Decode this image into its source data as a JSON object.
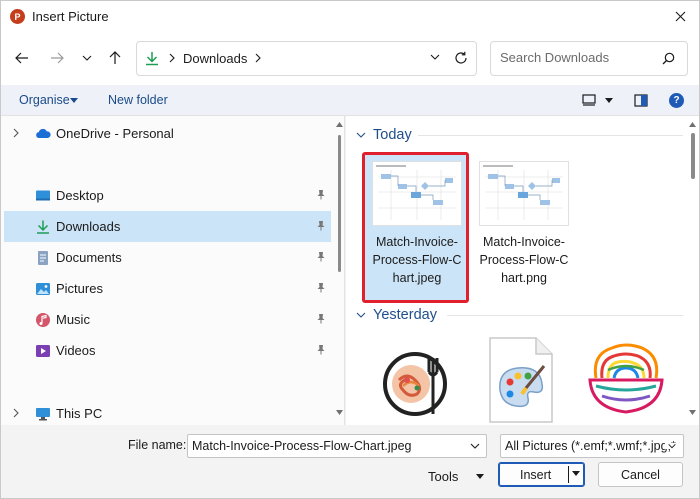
{
  "window": {
    "title": "Insert Picture",
    "app_icon_letter": "P",
    "app_color": "#c43e1c"
  },
  "address": {
    "location": "Downloads",
    "icon": "download-arrow-icon"
  },
  "search": {
    "placeholder": "Search Downloads"
  },
  "toolbar": {
    "organise_label": "Organise",
    "new_folder_label": "New folder",
    "help_label": "?"
  },
  "sidebar": {
    "items": [
      {
        "label": "OneDrive - Personal",
        "icon": "onedrive-cloud-icon",
        "pinned": false,
        "expandable": true
      },
      {
        "label": "Desktop",
        "icon": "desktop-icon",
        "pinned": true
      },
      {
        "label": "Downloads",
        "icon": "download-arrow-icon",
        "pinned": true,
        "selected": true
      },
      {
        "label": "Documents",
        "icon": "documents-icon",
        "pinned": true
      },
      {
        "label": "Pictures",
        "icon": "pictures-icon",
        "pinned": true
      },
      {
        "label": "Music",
        "icon": "music-icon",
        "pinned": true
      },
      {
        "label": "Videos",
        "icon": "videos-icon",
        "pinned": true
      },
      {
        "label": "This PC",
        "icon": "this-pc-icon",
        "pinned": false,
        "expandable": true
      }
    ]
  },
  "content": {
    "groups": [
      {
        "label": "Today",
        "files": [
          {
            "name": "Match-Invoice-Process-Flow-Chart.jpeg",
            "display": [
              "Match-Invoice-",
              "Process-Flow-C",
              "hart.jpeg"
            ],
            "selected": true
          },
          {
            "name": "Match-Invoice-Process-Flow-Chart.png",
            "display": [
              "Match-Invoice-",
              "Process-Flow-C",
              "hart.png"
            ],
            "selected": false
          }
        ]
      },
      {
        "label": "Yesterday",
        "files": [
          {
            "name": "",
            "icon": "food-plate-icon"
          },
          {
            "name": "",
            "icon": "paint-palette-file-icon"
          },
          {
            "name": "",
            "icon": "noodle-bowl-icon"
          }
        ]
      }
    ],
    "highlight_color": "#e0202c",
    "selection_color": "#cce4f7"
  },
  "footer": {
    "file_name_label": "File name:",
    "file_name_value": "Match-Invoice-Process-Flow-Chart.jpeg",
    "file_type_value": "All Pictures (*.emf;*.wmf;*.jpg;*",
    "tools_label": "Tools",
    "insert_label": "Insert",
    "cancel_label": "Cancel"
  },
  "accent_color": "#1f5bb6"
}
